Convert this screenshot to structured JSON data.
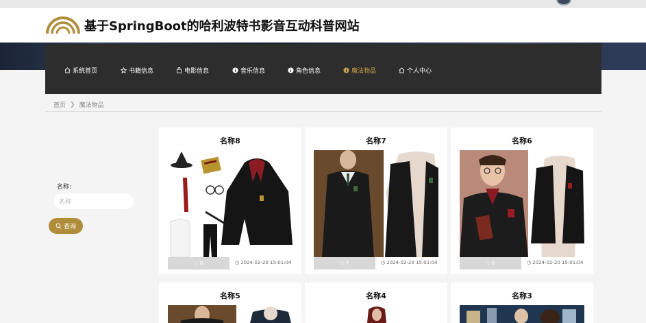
{
  "site": {
    "title": "基于SpringBoot的哈利波特书影音互动科普网站"
  },
  "nav": {
    "items": [
      {
        "label": "系统首页",
        "icon": "home-icon",
        "active": false
      },
      {
        "label": "书籍信息",
        "icon": "star-icon",
        "active": false
      },
      {
        "label": "电影信息",
        "icon": "bag-icon",
        "active": false
      },
      {
        "label": "音乐信息",
        "icon": "info-circle-icon",
        "active": false
      },
      {
        "label": "角色信息",
        "icon": "info-circle-icon",
        "active": false
      },
      {
        "label": "魔法物品",
        "icon": "info-circle-icon",
        "active": true
      },
      {
        "label": "个人中心",
        "icon": "home-icon",
        "active": false
      }
    ]
  },
  "breadcrumb": {
    "home": "首页",
    "current": "魔法物品"
  },
  "search": {
    "label": "名称:",
    "placeholder": "名称",
    "button_label": "查询"
  },
  "cards": [
    {
      "title": "名称8",
      "likes": "8",
      "time": "2024-02-20 15:01:04"
    },
    {
      "title": "名称7",
      "likes": "7",
      "time": "2024-02-20 15:01:04"
    },
    {
      "title": "名称6",
      "likes": "6",
      "time": "2024-02-20 15:01:04"
    },
    {
      "title": "名称5"
    },
    {
      "title": "名称4"
    },
    {
      "title": "名称3"
    }
  ],
  "colors": {
    "accent": "#b08d3a",
    "nav_bg": "#2d2d2d",
    "active_nav": "#c8a24a"
  }
}
